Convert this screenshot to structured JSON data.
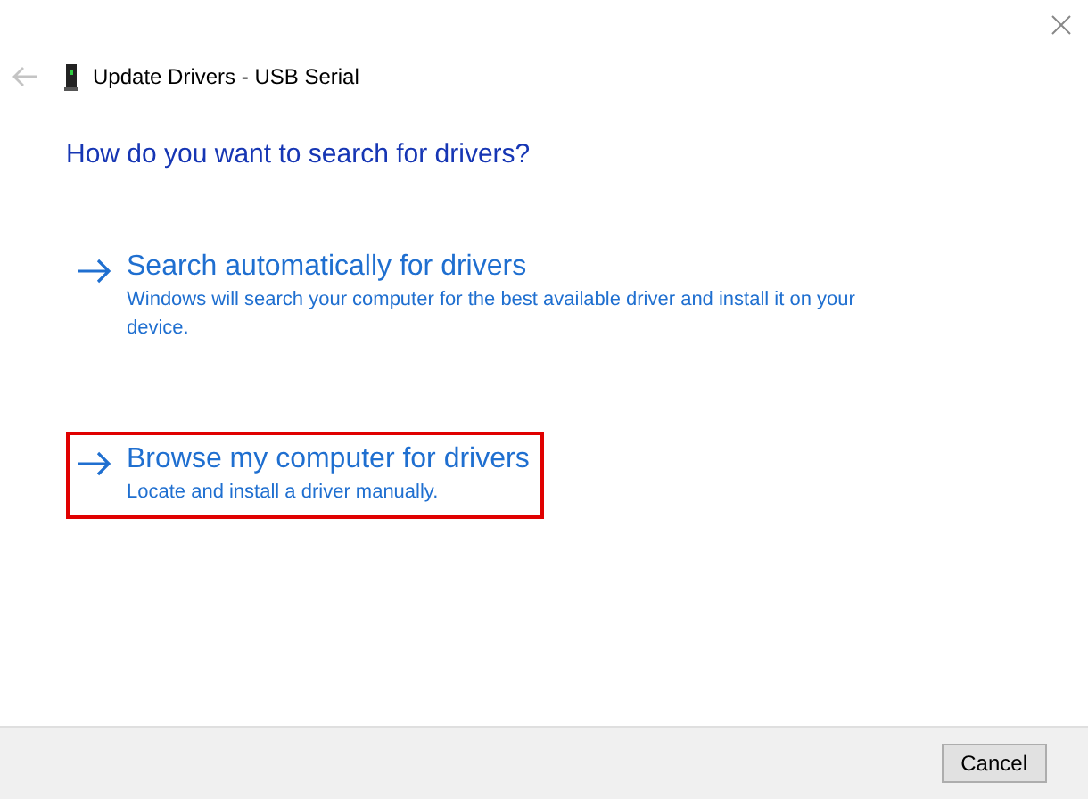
{
  "window": {
    "title": "Update Drivers - USB Serial",
    "back_disabled": true
  },
  "heading": "How do you want to search for drivers?",
  "options": [
    {
      "title": "Search automatically for drivers",
      "description": "Windows will search your computer for the best available driver and install it on your device.",
      "highlighted": false
    },
    {
      "title": "Browse my computer for drivers",
      "description": "Locate and install a driver manually.",
      "highlighted": true
    }
  ],
  "buttons": [
    "Cancel"
  ]
}
